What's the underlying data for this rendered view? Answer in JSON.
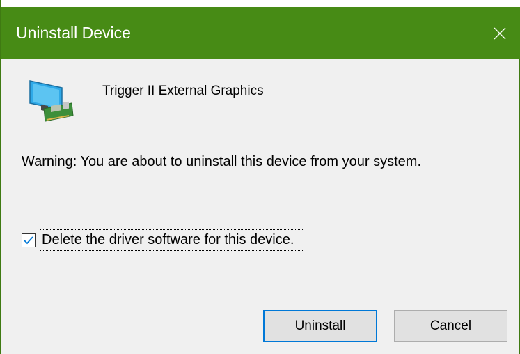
{
  "window": {
    "title": "Uninstall Device",
    "accent_color": "#478b15"
  },
  "device": {
    "name": "Trigger II External Graphics",
    "icon": "display-adapter-icon"
  },
  "warning_text": "Warning: You are about to uninstall this device from your system.",
  "delete_driver": {
    "label": "Delete the driver software for this device.",
    "checked": true
  },
  "buttons": {
    "uninstall_label": "Uninstall",
    "cancel_label": "Cancel"
  }
}
